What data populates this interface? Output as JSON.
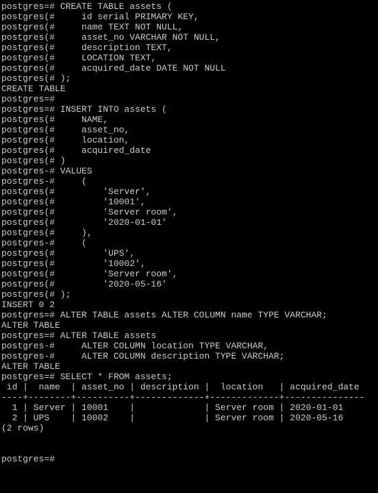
{
  "lines": [
    "postgres=# CREATE TABLE assets (",
    "postgres(#     id serial PRIMARY KEY,",
    "postgres(#     name TEXT NOT NULL,",
    "postgres(#     asset_no VARCHAR NOT NULL,",
    "postgres(#     description TEXT,",
    "postgres(#     LOCATION TEXT,",
    "postgres(#     acquired_date DATE NOT NULL",
    "postgres(# );",
    "CREATE TABLE",
    "postgres=#",
    "postgres=# INSERT INTO assets (",
    "postgres(#     NAME,",
    "postgres(#     asset_no,",
    "postgres(#     location,",
    "postgres(#     acquired_date",
    "postgres(# )",
    "postgres-# VALUES",
    "postgres-#     (",
    "postgres(#         'Server',",
    "postgres(#         '10001',",
    "postgres(#         'Server room',",
    "postgres(#         '2020-01-01'",
    "postgres(#     ),",
    "postgres-#     (",
    "postgres(#         'UPS',",
    "postgres(#         '10002',",
    "postgres(#         'Server room',",
    "postgres(#         '2020-05-16'",
    "postgres(# );",
    "INSERT 0 2",
    "postgres=# ALTER TABLE assets ALTER COLUMN name TYPE VARCHAR;",
    "ALTER TABLE",
    "postgres=# ALTER TABLE assets",
    "postgres-#     ALTER COLUMN location TYPE VARCHAR,",
    "postgres-#     ALTER COLUMN description TYPE VARCHAR;",
    "ALTER TABLE",
    "postgres=# SELECT * FROM assets;",
    " id |  name  | asset_no | description |  location   | acquired_date",
    "----+--------+----------+-------------+-------------+---------------",
    "  1 | Server | 10001    |             | Server room | 2020-01-01",
    "  2 | UPS    | 10002    |             | Server room | 2020-05-16",
    "(2 rows)",
    "",
    "",
    "postgres=#"
  ],
  "table_data": {
    "columns": [
      "id",
      "name",
      "asset_no",
      "description",
      "location",
      "acquired_date"
    ],
    "rows": [
      {
        "id": 1,
        "name": "Server",
        "asset_no": "10001",
        "description": "",
        "location": "Server room",
        "acquired_date": "2020-01-01"
      },
      {
        "id": 2,
        "name": "UPS",
        "asset_no": "10002",
        "description": "",
        "location": "Server room",
        "acquired_date": "2020-05-16"
      }
    ],
    "row_count_text": "(2 rows)"
  }
}
